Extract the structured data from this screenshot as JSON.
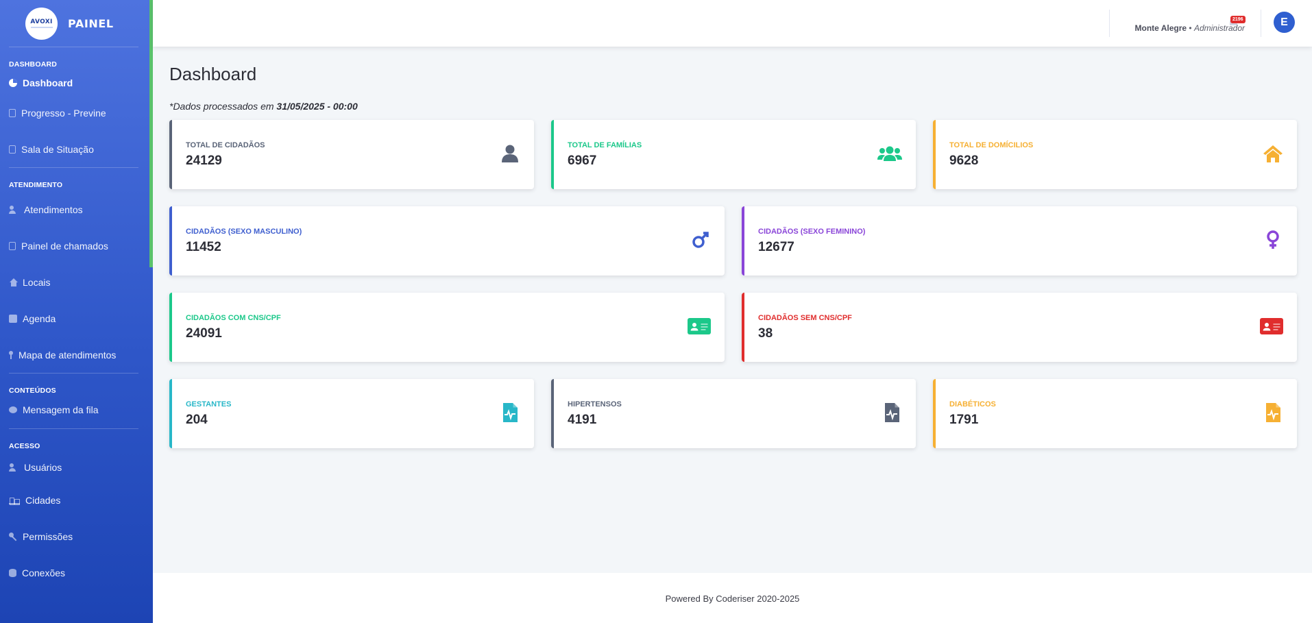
{
  "sidebar": {
    "brand_logo_text": "AVOXI",
    "brand_title": "PAINEL",
    "sections": [
      "DASHBOARD",
      "ATENDIMENTO",
      "CONTEÚDOS",
      "ACESSO"
    ],
    "items": [
      {
        "label": "Dashboard",
        "icon": "pie-chart-icon"
      },
      {
        "label": "Progresso - Previne",
        "icon": "clipboard-icon"
      },
      {
        "label": "Sala de Situação",
        "icon": "building-icon"
      },
      {
        "label": "Atendimentos",
        "icon": "user-clock-icon"
      },
      {
        "label": "Painel de chamados",
        "icon": "calendar-icon"
      },
      {
        "label": "Locais",
        "icon": "home-icon"
      },
      {
        "label": "Agenda",
        "icon": "calendar-icon"
      },
      {
        "label": "Mapa de atendimentos",
        "icon": "map-pin-icon"
      },
      {
        "label": "Mensagem da fila",
        "icon": "comment-icon"
      },
      {
        "label": "Usuários",
        "icon": "users-icon"
      },
      {
        "label": "Cidades",
        "icon": "city-icon"
      },
      {
        "label": "Permissões",
        "icon": "key-icon"
      },
      {
        "label": "Conexões",
        "icon": "database-icon"
      }
    ]
  },
  "topbar": {
    "notification_count": "2196",
    "city": "Monte Alegre",
    "separator": "•",
    "role": "Administrador",
    "avatar_initial": "E"
  },
  "main": {
    "title": "Dashboard",
    "processed_prefix": "*Dados processados em ",
    "processed_date": "31/05/2025 - 00:00"
  },
  "cards": [
    {
      "label": "TOTAL DE CIDADÃOS",
      "value": "24129",
      "color": "#5a6478",
      "icon": "user-icon"
    },
    {
      "label": "TOTAL DE FAMÍLIAS",
      "value": "6967",
      "color": "#1cc88a",
      "icon": "users-icon"
    },
    {
      "label": "TOTAL DE DOMÍCILIOS",
      "value": "9628",
      "color": "#f6b033",
      "icon": "home-icon"
    },
    {
      "label": "CIDADÃOS (SEXO MASCULINO)",
      "value": "11452",
      "color": "#3f5fcf",
      "icon": "mars-icon"
    },
    {
      "label": "CIDADÃOS (SEXO FEMININO)",
      "value": "12677",
      "color": "#8a45d8",
      "icon": "venus-icon"
    },
    {
      "label": "CIDADÃOS COM CNS/CPF",
      "value": "24091",
      "color": "#1cc88a",
      "icon": "id-card-icon"
    },
    {
      "label": "CIDADÃOS SEM CNS/CPF",
      "value": "38",
      "color": "#e02d2d",
      "icon": "id-card-icon"
    },
    {
      "label": "GESTANTES",
      "value": "204",
      "color": "#28b7c8",
      "icon": "file-medical-icon"
    },
    {
      "label": "HIPERTENSOS",
      "value": "4191",
      "color": "#5a6478",
      "icon": "file-medical-icon"
    },
    {
      "label": "DIABÉTICOS",
      "value": "1791",
      "color": "#f6b033",
      "icon": "file-medical-icon"
    }
  ],
  "footer": {
    "text": "Powered By Coderiser 2020-2025"
  }
}
